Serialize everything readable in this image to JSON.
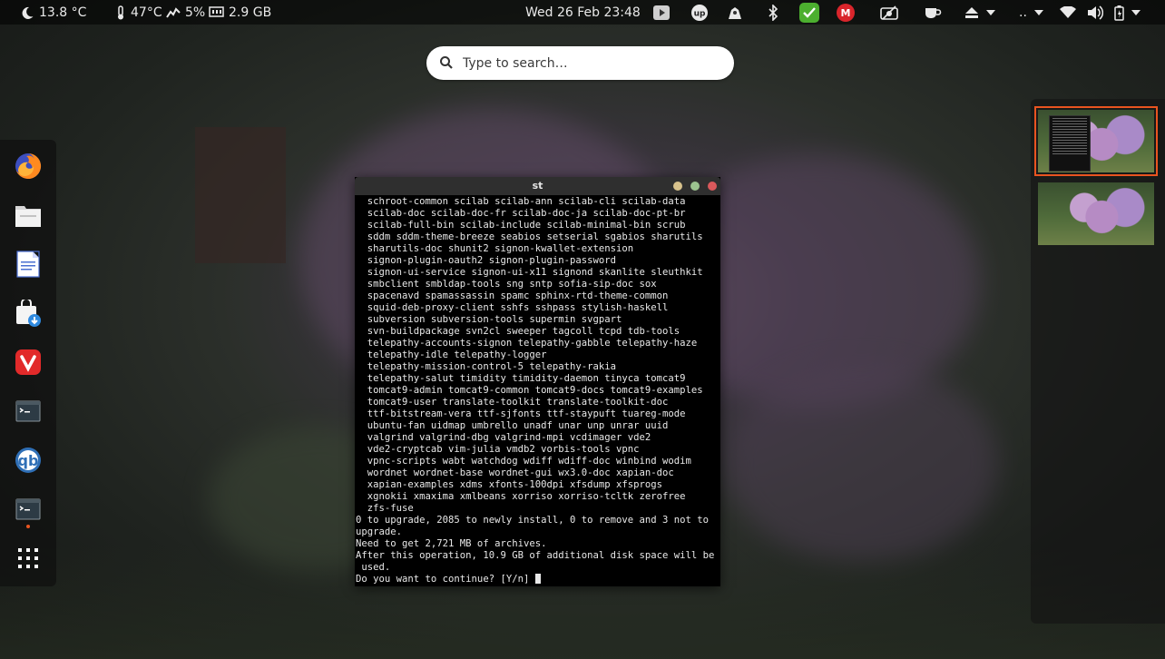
{
  "topbar": {
    "temperature": "13.8 °C",
    "cpu_temp": "47°C",
    "cpu_load": "5%",
    "memory": "2.9 GB",
    "datetime": "Wed 26 Feb  23:48",
    "overflow_label": ".."
  },
  "search": {
    "placeholder": "Type to search…"
  },
  "dock": {
    "items": [
      "firefox",
      "files",
      "text-editor",
      "software-store",
      "vivaldi",
      "terminal",
      "qbittorrent",
      "terminal-running",
      "show-applications"
    ]
  },
  "terminal": {
    "title": "st",
    "lines": [
      "  schroot-common scilab scilab-ann scilab-cli scilab-data",
      "  scilab-doc scilab-doc-fr scilab-doc-ja scilab-doc-pt-br",
      "  scilab-full-bin scilab-include scilab-minimal-bin scrub",
      "  sddm sddm-theme-breeze seabios setserial sgabios sharutils",
      "  sharutils-doc shunit2 signon-kwallet-extension",
      "  signon-plugin-oauth2 signon-plugin-password",
      "  signon-ui-service signon-ui-x11 signond skanlite sleuthkit",
      "  smbclient smbldap-tools sng sntp sofia-sip-doc sox",
      "  spacenavd spamassassin spamc sphinx-rtd-theme-common",
      "  squid-deb-proxy-client sshfs sshpass stylish-haskell",
      "  subversion subversion-tools supermin svgpart",
      "  svn-buildpackage svn2cl sweeper tagcoll tcpd tdb-tools",
      "  telepathy-accounts-signon telepathy-gabble telepathy-haze",
      "  telepathy-idle telepathy-logger",
      "  telepathy-mission-control-5 telepathy-rakia",
      "  telepathy-salut timidity timidity-daemon tinyca tomcat9",
      "  tomcat9-admin tomcat9-common tomcat9-docs tomcat9-examples",
      "  tomcat9-user translate-toolkit translate-toolkit-doc",
      "  ttf-bitstream-vera ttf-sjfonts ttf-staypuft tuareg-mode",
      "  ubuntu-fan uidmap umbrello unadf unar unp unrar uuid",
      "  valgrind valgrind-dbg valgrind-mpi vcdimager vde2",
      "  vde2-cryptcab vim-julia vmdb2 vorbis-tools vpnc",
      "  vpnc-scripts wabt watchdog wdiff wdiff-doc winbind wodim",
      "  wordnet wordnet-base wordnet-gui wx3.0-doc xapian-doc",
      "  xapian-examples xdms xfonts-100dpi xfsdump xfsprogs",
      "  xgnokii xmaxima xmlbeans xorriso xorriso-tcltk zerofree",
      "  zfs-fuse",
      "0 to upgrade, 2085 to newly install, 0 to remove and 3 not to",
      "upgrade.",
      "Need to get 2,721 MB of archives.",
      "After this operation, 10.9 GB of additional disk space will be",
      " used."
    ],
    "prompt": "Do you want to continue? [Y/n] "
  },
  "colors": {
    "accent": "#e95420",
    "btn_minimize": "#d7c28c",
    "btn_maximize": "#9bc28f",
    "btn_close": "#d9595b"
  }
}
